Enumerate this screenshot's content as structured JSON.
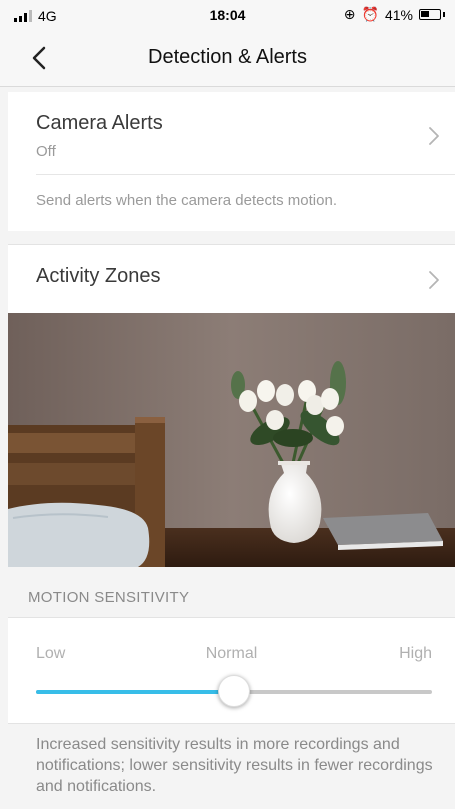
{
  "status": {
    "network": "4G",
    "time": "18:04",
    "battery": "41%"
  },
  "nav": {
    "title": "Detection & Alerts"
  },
  "camera_alerts": {
    "title": "Camera Alerts",
    "value": "Off",
    "description": "Send alerts when the camera detects motion."
  },
  "activity_zones": {
    "title": "Activity Zones"
  },
  "motion": {
    "header": "MOTION SENSITIVITY",
    "low": "Low",
    "normal": "Normal",
    "high": "High",
    "level": 0.5,
    "footer": "Increased sensitivity results in more recordings and notifications; lower sensitivity results in fewer recordings and notifications."
  },
  "colors": {
    "accent": "#37bde8"
  }
}
